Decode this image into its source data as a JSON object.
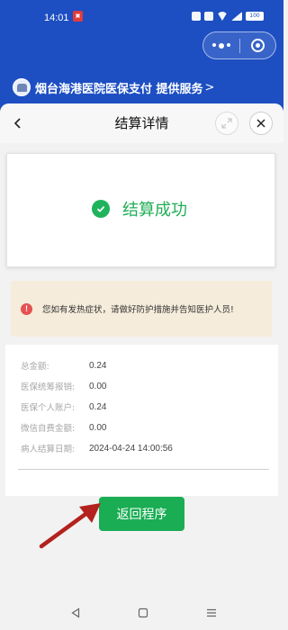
{
  "status_bar": {
    "time": "14:01",
    "battery": "100"
  },
  "provider": {
    "label": "烟台海港医院医保支付 提供服务",
    "chevron": ">"
  },
  "sheet": {
    "title": "结算详情"
  },
  "success": {
    "text": "结算成功",
    "color": "#1fae55"
  },
  "warning": {
    "icon_glyph": "!",
    "text": "您如有发热症状，请做好防护措施并告知医护人员!"
  },
  "details": [
    {
      "label": "总金额:",
      "value": "0.24"
    },
    {
      "label": "医保统筹报销:",
      "value": "0.00"
    },
    {
      "label": "医保个人账户:",
      "value": "0.24"
    },
    {
      "label": "微信自费金额:",
      "value": "0.00"
    },
    {
      "label": "病人结算日期:",
      "value": "2024-04-24 14:00:56"
    }
  ],
  "return_button": {
    "label": "返回程序",
    "color": "#1aad54"
  },
  "colors": {
    "header_blue": "#1d4fc2",
    "arrow_red": "#b3221e"
  }
}
